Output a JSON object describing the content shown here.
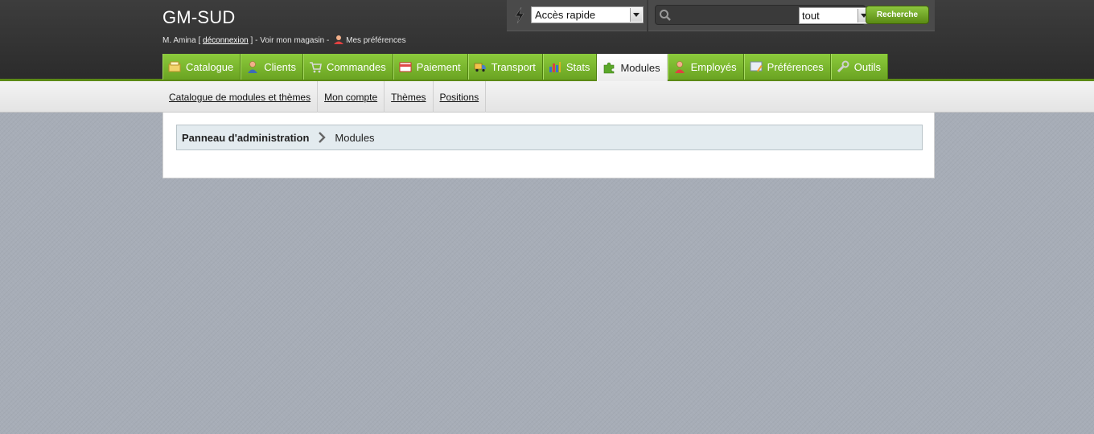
{
  "header": {
    "shop_name": "GM-SUD",
    "user_name": "M. Amina",
    "bracket_open": " [ ",
    "logout_label": "déconnexion",
    "bracket_close": " ] - ",
    "view_shop_label": "Voir mon magasin",
    "dash": " - ",
    "preferences_label": "Mes préférences"
  },
  "quick_access": {
    "selected": "Accès rapide",
    "icon": "lightning-icon"
  },
  "search": {
    "placeholder": "",
    "scope_selected": "tout",
    "button_label": "Recherche",
    "icon": "search-icon"
  },
  "main_tabs": [
    {
      "label": "Catalogue",
      "icon": "catalog-icon",
      "active": false
    },
    {
      "label": "Clients",
      "icon": "customer-icon",
      "active": false
    },
    {
      "label": "Commandes",
      "icon": "cart-icon",
      "active": false
    },
    {
      "label": "Paiement",
      "icon": "payment-icon",
      "active": false
    },
    {
      "label": "Transport",
      "icon": "truck-icon",
      "active": false
    },
    {
      "label": "Stats",
      "icon": "chart-icon",
      "active": false
    },
    {
      "label": "Modules",
      "icon": "puzzle-icon",
      "active": true
    },
    {
      "label": "Employés",
      "icon": "employee-icon",
      "active": false
    },
    {
      "label": "Préférences",
      "icon": "preferences-icon",
      "active": false
    },
    {
      "label": "Outils",
      "icon": "tools-icon",
      "active": false
    }
  ],
  "sub_tabs": [
    {
      "label": "Catalogue de modules et thèmes"
    },
    {
      "label": "Mon compte"
    },
    {
      "label": "Thèmes"
    },
    {
      "label": "Positions"
    }
  ],
  "breadcrumb": {
    "root": "Panneau d'administration",
    "current": "Modules"
  },
  "colors": {
    "tab_green": "#7bb72e",
    "header_dark": "#333333",
    "breadcrumb_bg": "#e3ebef",
    "page_bg": "#a7adb7"
  }
}
